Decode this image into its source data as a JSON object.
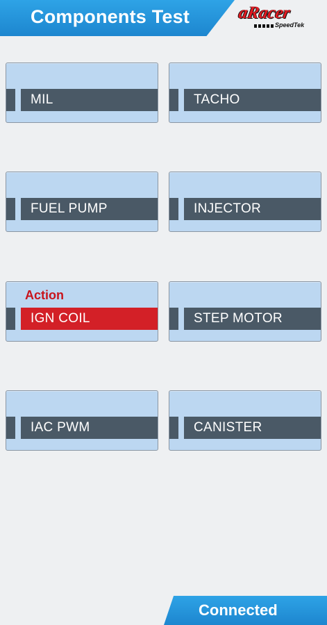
{
  "header": {
    "title": "Components Test"
  },
  "logo": {
    "main": "aRacer",
    "sub": "SpeedTek"
  },
  "components": [
    {
      "label": "MIL"
    },
    {
      "label": "TACHO"
    },
    {
      "label": "FUEL PUMP"
    },
    {
      "label": "INJECTOR"
    },
    {
      "label": "IGN COIL",
      "action": "Action",
      "active": true
    },
    {
      "label": "STEP MOTOR"
    },
    {
      "label": "IAC PWM"
    },
    {
      "label": "CANISTER"
    }
  ],
  "footer": {
    "status": "Connected"
  },
  "colors": {
    "header_blue": "#1d86cf",
    "tile_bg": "#bcd7f1",
    "bar": "#4a5966",
    "active": "#d32027"
  }
}
